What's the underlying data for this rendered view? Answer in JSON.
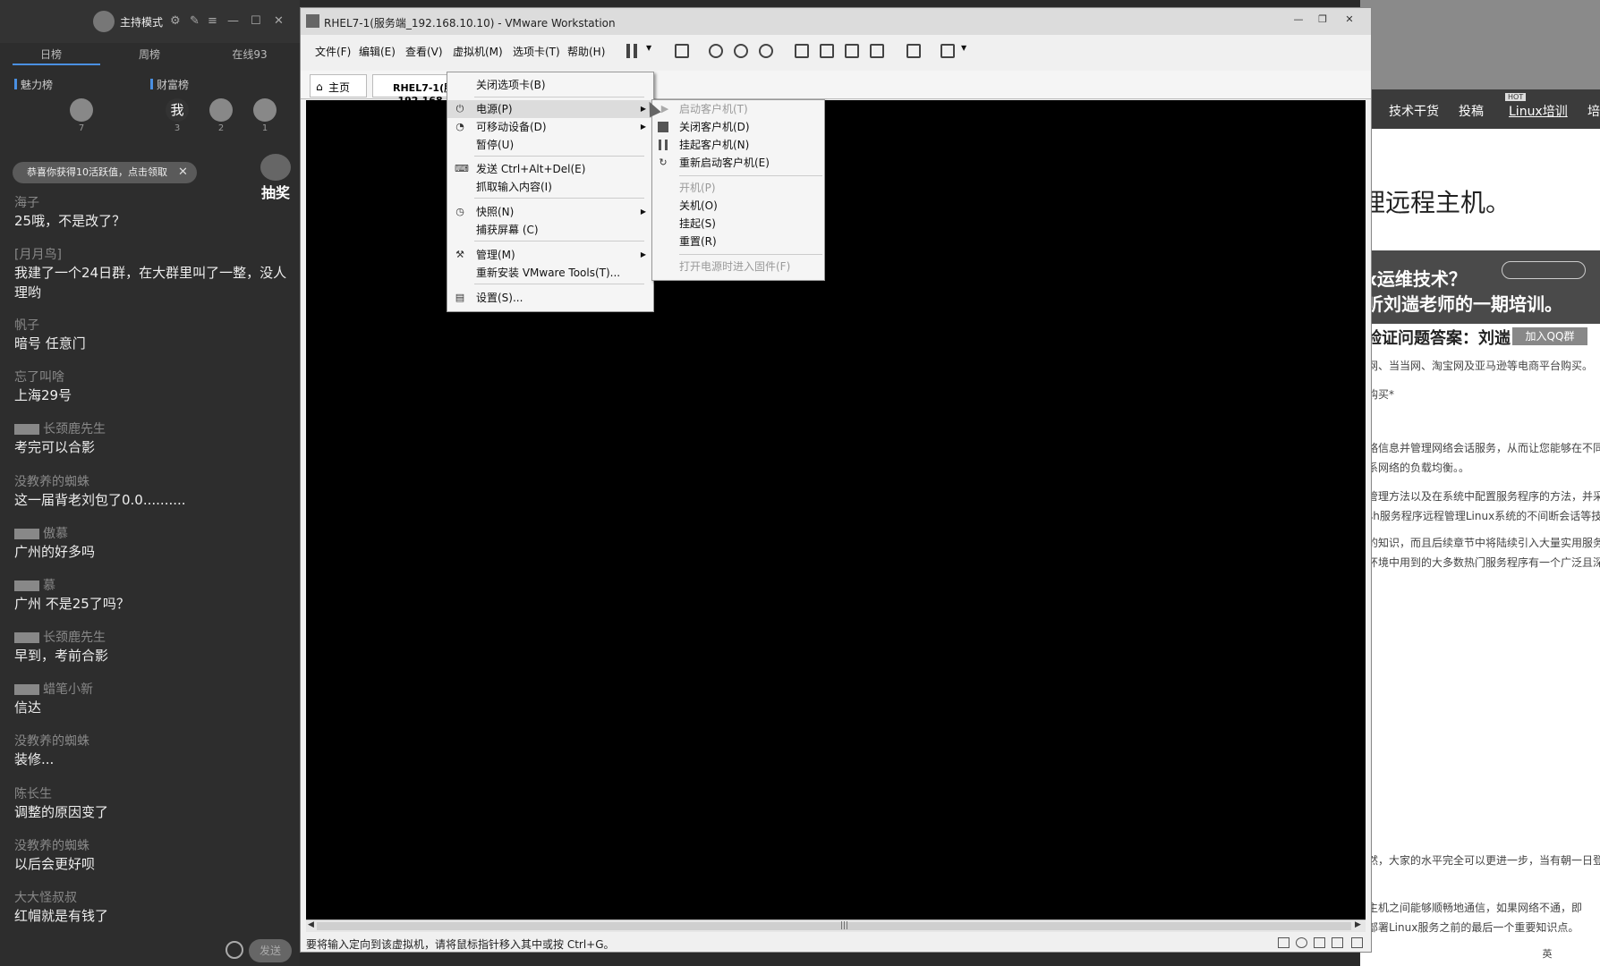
{
  "chat": {
    "host_label": "主持模式",
    "tabs": [
      "日榜",
      "周榜",
      "在线93"
    ],
    "rank_left": "魅力榜",
    "rank_right": "财富榜",
    "rank_avatar_text": "我",
    "rank_nums": [
      "7",
      "3",
      "2",
      "1"
    ],
    "notice": "恭喜你获得10活跃值，点击领取",
    "lottery": "抽奖",
    "messages": [
      {
        "name": "海子",
        "text": "25哦，不是改了？"
      },
      {
        "name": "[月月鸟]",
        "text": "我建了一个24日群，在大群里叫了一整，没人理哟"
      },
      {
        "name": "帆子",
        "text": "暗号  任意门"
      },
      {
        "name": "忘了叫啥",
        "text": "上海29号"
      },
      {
        "name": "长颈鹿先生",
        "text": "考完可以合影"
      },
      {
        "name": "没教养的蜘蛛",
        "text": "这一届背老刘包了0.0.........."
      },
      {
        "name": "傲慕",
        "text": "广州的好多吗"
      },
      {
        "name": "慕",
        "text": "广州 不是25了吗？"
      },
      {
        "name": "长颈鹿先生",
        "text": "早到，考前合影"
      },
      {
        "name": "蜡笔小新",
        "text": "信达"
      },
      {
        "name": "没教养的蜘蛛",
        "text": "装修..."
      },
      {
        "name": "陈长生",
        "text": "调整的原因变了"
      },
      {
        "name": "没教养的蜘蛛",
        "text": "以后会更好呗"
      },
      {
        "name": "大大怪叔叔",
        "text": "红帽就是有钱了"
      }
    ],
    "send_label": "发送"
  },
  "vmware": {
    "title": "RHEL7-1(服务端_192.168.10.10) - VMware Workstation",
    "menus": [
      "文件(F)",
      "编辑(E)",
      "查看(V)",
      "虚拟机(M)",
      "选项卡(T)",
      "帮助(H)"
    ],
    "tab_home": "主页",
    "tab_vm": "RHEL7-1(服务端_192.168.10.10)",
    "status": "要将输入定向到该虚拟机，请将鼠标指针移入其中或按 Ctrl+G。"
  },
  "context_menu": {
    "close_tab": "关闭选项卡(B)",
    "power": "电源(P)",
    "removable": "可移动设备(D)",
    "pause": "暂停(U)",
    "send_cad": "发送 Ctrl+Alt+Del(E)",
    "grab_input": "抓取输入内容(I)",
    "snapshot": "快照(N)",
    "capture": "捕获屏幕 (C)",
    "manage": "管理(M)",
    "reinstall_tools": "重新安装 VMware Tools(T)...",
    "settings": "设置(S)..."
  },
  "power_menu": {
    "start_guest": "启动客户机(T)",
    "shutdown_guest": "关闭客户机(D)",
    "suspend_guest": "挂起客户机(N)",
    "restart_guest": "重新启动客户机(E)",
    "power_on": "开机(P)",
    "power_off": "关机(O)",
    "suspend": "挂起(S)",
    "reset": "重置(R)",
    "power_on_firmware": "打开电源时进入固件(F)"
  },
  "browser": {
    "nav": [
      "技术干货",
      "投稿",
      "Linux培训",
      "培"
    ],
    "hot_badge": "HOT",
    "heading": "理远程主机。",
    "banner_line1": "x运维技术？",
    "banner_line2": "听刘遄老师的一期培训。",
    "answer": "验证问题答案：刘遄",
    "qq_button": "加入QQ群",
    "paragraphs": [
      "网、当当网、淘宝网及亚马逊等电商平台购买。",
      "购买*",
      "略信息并管理网络会话服务，从而让您能够在不同",
      "系网络的负载均衡。。",
      "管理方法以及在系统中配置服务程序的方法，并采用",
      "sh服务程序远程管理Linux系统的不间断会话等技术",
      "的知识，而且后续章节中将陆续引入大量实用服务的",
      "环境中用到的大多数热门服务程序有一个广泛且深入",
      "然，大家的水平完全可以更进一步，当有朝一日登顶",
      "主机之间能够顺畅地通信，如果网络不通，即",
      "部署Linux服务之前的最后一个重要知识点。"
    ],
    "ime": "英"
  }
}
